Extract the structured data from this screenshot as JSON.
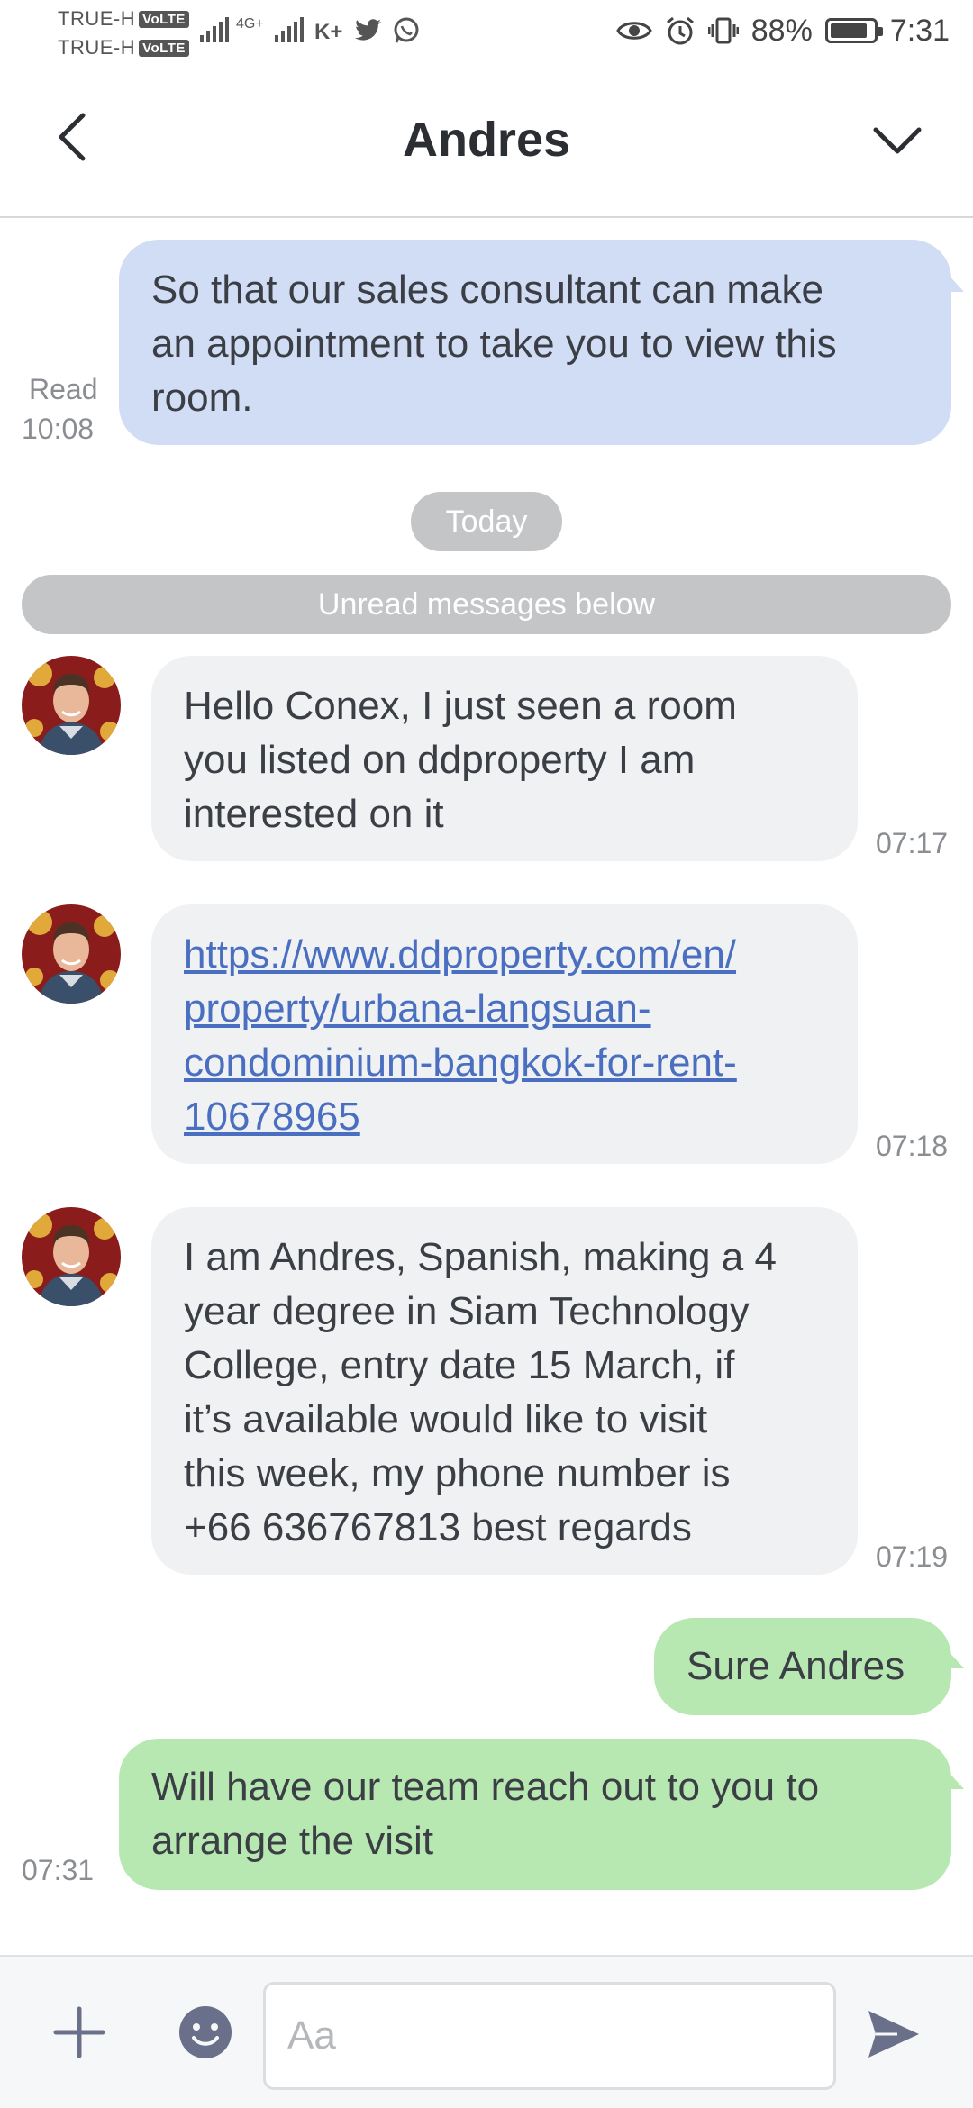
{
  "status_bar": {
    "carrier_1": "TRUE-H",
    "carrier_2": "TRUE-H",
    "volte_badge": "VoLTE",
    "network": "4G+",
    "battery_percent": "88%",
    "battery_level": 0.88,
    "time": "7:31"
  },
  "header": {
    "title": "Andres"
  },
  "messages": [
    {
      "direction": "outgoing",
      "text": "So that our sales consultant can make an appointment to take you to view this room.",
      "lines": [
        "So that our sales consultant can make",
        "an appointment to take you to view this",
        "room."
      ],
      "status": "Read",
      "time": "10:08"
    },
    {
      "type": "date_divider",
      "text": "Today"
    },
    {
      "type": "unread_divider",
      "text": "Unread messages below"
    },
    {
      "direction": "incoming",
      "lines": [
        "Hello Conex, I just seen a room",
        "you listed on ddproperty I am",
        "interested on it"
      ],
      "time": "07:17"
    },
    {
      "direction": "incoming",
      "link_lines": [
        "https://www.ddproperty.com/en/",
        "property/urbana-langsuan-",
        "condominium-bangkok-for-rent-",
        "10678965"
      ],
      "time": "07:18"
    },
    {
      "direction": "incoming",
      "lines": [
        "I am Andres, Spanish, making a 4",
        "year degree in Siam Technology",
        "College, entry date 15 March, if",
        "it’s available would like to visit",
        "this week, my phone number is",
        "+66 636767813 best regards"
      ],
      "time": "07:19"
    },
    {
      "direction": "outgoing",
      "lines": [
        "Sure Andres"
      ]
    },
    {
      "direction": "outgoing",
      "lines": [
        "Will have our team reach out to you to",
        "arrange the visit"
      ],
      "time": "07:31"
    }
  ],
  "composer": {
    "placeholder": "Aa"
  },
  "colors": {
    "outgoing_blue": "#d1dcf5",
    "outgoing_green": "#b8e8b2",
    "incoming": "#f0f1f3",
    "link": "#4a6fc1",
    "divider_pill": "#c4c5c7",
    "icon": "#6a7089"
  },
  "icons": {
    "back": "chevron-left-icon",
    "menu": "chevron-down-icon",
    "add": "plus-icon",
    "emoji": "smiley-icon",
    "send": "send-icon",
    "avatar": "user-avatar"
  }
}
